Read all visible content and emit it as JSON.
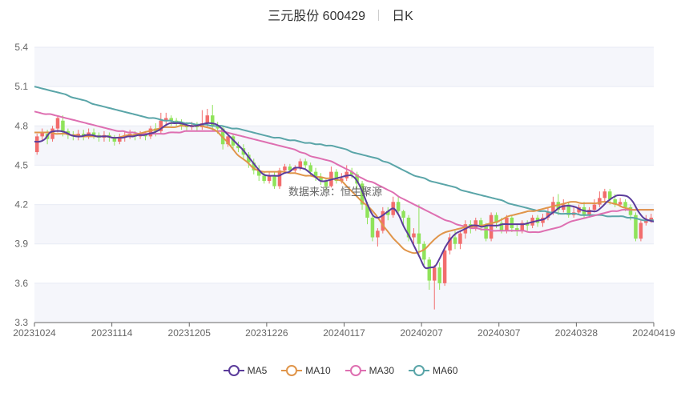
{
  "header": {
    "stock": "三元股份 600429",
    "period": "日K"
  },
  "watermark": "数据来源：恒生聚源",
  "legend": [
    {
      "label": "MA5",
      "color": "#5b3c9b"
    },
    {
      "label": "MA10",
      "color": "#e0954a"
    },
    {
      "label": "MA30",
      "color": "#de6fb1"
    },
    {
      "label": "MA60",
      "color": "#5aa5a8"
    }
  ],
  "colors": {
    "up": "#f26d6d",
    "down": "#8fe35a",
    "grid": "#e8ebf5",
    "band": "#f5f6fb"
  },
  "chart_data": {
    "type": "candlestick",
    "y_axis": {
      "min": 3.3,
      "max": 5.4,
      "ticks": [
        "3.3",
        "3.6",
        "3.9",
        "4.2",
        "4.5",
        "4.8",
        "5.1",
        "5.4"
      ]
    },
    "x_axis": {
      "tick_labels": [
        "20231024",
        "20231114",
        "20231205",
        "20231226",
        "20240117",
        "20240207",
        "20240307",
        "20240328",
        "20240419"
      ]
    },
    "grid": true,
    "legend_position": "bottom-center",
    "candles": [
      [
        4.6,
        4.72,
        4.58,
        4.74
      ],
      [
        4.72,
        4.75,
        4.68,
        4.78
      ],
      [
        4.74,
        4.7,
        4.66,
        4.77
      ],
      [
        4.7,
        4.78,
        4.68,
        4.8
      ],
      [
        4.78,
        4.86,
        4.75,
        4.88
      ],
      [
        4.84,
        4.76,
        4.72,
        4.88
      ],
      [
        4.76,
        4.73,
        4.7,
        4.78
      ],
      [
        4.73,
        4.72,
        4.69,
        4.76
      ],
      [
        4.72,
        4.74,
        4.69,
        4.77
      ],
      [
        4.74,
        4.72,
        4.69,
        4.77
      ],
      [
        4.72,
        4.75,
        4.7,
        4.78
      ],
      [
        4.75,
        4.73,
        4.7,
        4.78
      ],
      [
        4.73,
        4.71,
        4.68,
        4.75
      ],
      [
        4.71,
        4.73,
        4.68,
        4.76
      ],
      [
        4.73,
        4.71,
        4.68,
        4.75
      ],
      [
        4.71,
        4.68,
        4.65,
        4.73
      ],
      [
        4.68,
        4.71,
        4.66,
        4.74
      ],
      [
        4.71,
        4.73,
        4.68,
        4.76
      ],
      [
        4.73,
        4.74,
        4.7,
        4.77
      ],
      [
        4.74,
        4.72,
        4.69,
        4.76
      ],
      [
        4.72,
        4.73,
        4.7,
        4.76
      ],
      [
        4.73,
        4.72,
        4.69,
        4.76
      ],
      [
        4.72,
        4.78,
        4.7,
        4.8
      ],
      [
        4.78,
        4.76,
        4.72,
        4.82
      ],
      [
        4.76,
        4.84,
        4.74,
        4.9
      ],
      [
        4.84,
        4.86,
        4.8,
        4.9
      ],
      [
        4.86,
        4.84,
        4.8,
        4.88
      ],
      [
        4.84,
        4.83,
        4.8,
        4.86
      ],
      [
        4.83,
        4.8,
        4.77,
        4.85
      ],
      [
        4.8,
        4.79,
        4.76,
        4.83
      ],
      [
        4.79,
        4.8,
        4.77,
        4.83
      ],
      [
        4.8,
        4.79,
        4.76,
        4.83
      ],
      [
        4.79,
        4.82,
        4.77,
        4.92
      ],
      [
        4.82,
        4.88,
        4.79,
        4.93
      ],
      [
        4.88,
        4.8,
        4.76,
        4.96
      ],
      [
        4.8,
        4.78,
        4.74,
        4.83
      ],
      [
        4.78,
        4.66,
        4.62,
        4.8
      ],
      [
        4.66,
        4.72,
        4.64,
        4.75
      ],
      [
        4.72,
        4.65,
        4.62,
        4.74
      ],
      [
        4.65,
        4.63,
        4.6,
        4.68
      ],
      [
        4.63,
        4.58,
        4.55,
        4.66
      ],
      [
        4.58,
        4.52,
        4.48,
        4.6
      ],
      [
        4.52,
        4.46,
        4.43,
        4.55
      ],
      [
        4.46,
        4.42,
        4.38,
        4.5
      ],
      [
        4.42,
        4.38,
        4.36,
        4.45
      ],
      [
        4.38,
        4.42,
        4.36,
        4.45
      ],
      [
        4.42,
        4.34,
        4.32,
        4.45
      ],
      [
        4.34,
        4.46,
        4.32,
        4.48
      ],
      [
        4.46,
        4.49,
        4.44,
        4.51
      ],
      [
        4.49,
        4.46,
        4.44,
        4.51
      ],
      [
        4.46,
        4.48,
        4.44,
        4.5
      ],
      [
        4.48,
        4.53,
        4.46,
        4.55
      ],
      [
        4.53,
        4.5,
        4.47,
        4.55
      ],
      [
        4.5,
        4.45,
        4.42,
        4.52
      ],
      [
        4.45,
        4.41,
        4.38,
        4.48
      ],
      [
        4.41,
        4.38,
        4.35,
        4.44
      ],
      [
        4.38,
        4.34,
        4.31,
        4.4
      ],
      [
        4.34,
        4.45,
        4.33,
        4.49
      ],
      [
        4.45,
        4.38,
        4.36,
        4.47
      ],
      [
        4.38,
        4.4,
        4.36,
        4.44
      ],
      [
        4.4,
        4.45,
        4.38,
        4.5
      ],
      [
        4.45,
        4.43,
        4.4,
        4.48
      ],
      [
        4.43,
        4.36,
        4.32,
        4.45
      ],
      [
        4.36,
        4.2,
        4.16,
        4.38
      ],
      [
        4.2,
        4.1,
        4.05,
        4.22
      ],
      [
        4.1,
        3.95,
        3.92,
        4.12
      ],
      [
        3.95,
        4.0,
        3.88,
        4.02
      ],
      [
        4.0,
        4.15,
        3.98,
        4.18
      ],
      [
        4.15,
        4.12,
        4.08,
        4.18
      ],
      [
        4.12,
        4.22,
        4.1,
        4.26
      ],
      [
        4.22,
        4.15,
        4.12,
        4.26
      ],
      [
        4.15,
        4.1,
        4.04,
        4.16
      ],
      [
        4.1,
        3.95,
        3.92,
        4.12
      ],
      [
        3.95,
        3.98,
        3.9,
        4.02
      ],
      [
        3.98,
        3.9,
        3.8,
        4.2
      ],
      [
        3.9,
        3.78,
        3.74,
        3.92
      ],
      [
        3.78,
        3.62,
        3.55,
        3.8
      ],
      [
        3.62,
        3.72,
        3.4,
        3.74
      ],
      [
        3.72,
        3.6,
        3.55,
        3.76
      ],
      [
        3.6,
        3.85,
        3.58,
        3.88
      ],
      [
        3.85,
        3.95,
        3.82,
        3.98
      ],
      [
        3.95,
        3.9,
        3.86,
        4.0
      ],
      [
        3.9,
        3.98,
        3.86,
        4.0
      ],
      [
        3.98,
        4.05,
        3.94,
        4.08
      ],
      [
        4.05,
        4.02,
        3.98,
        4.08
      ],
      [
        4.02,
        4.08,
        4.0,
        4.1
      ],
      [
        4.08,
        4.04,
        4.0,
        4.1
      ],
      [
        4.04,
        3.94,
        3.92,
        4.06
      ],
      [
        3.94,
        4.12,
        3.92,
        4.14
      ],
      [
        4.12,
        4.06,
        4.02,
        4.14
      ],
      [
        4.06,
        4.0,
        3.98,
        4.1
      ],
      [
        4.0,
        4.1,
        3.98,
        4.12
      ],
      [
        4.1,
        4.02,
        3.99,
        4.12
      ],
      [
        4.02,
        4.0,
        3.96,
        4.05
      ],
      [
        4.0,
        4.06,
        3.98,
        4.08
      ],
      [
        4.06,
        4.04,
        4.0,
        4.08
      ],
      [
        4.04,
        4.1,
        4.02,
        4.12
      ],
      [
        4.1,
        4.06,
        4.03,
        4.12
      ],
      [
        4.06,
        4.1,
        4.03,
        4.13
      ],
      [
        4.1,
        4.14,
        4.08,
        4.18
      ],
      [
        4.14,
        4.22,
        4.12,
        4.26
      ],
      [
        4.22,
        4.16,
        4.12,
        4.28
      ],
      [
        4.16,
        4.2,
        4.14,
        4.24
      ],
      [
        4.2,
        4.12,
        4.1,
        4.22
      ],
      [
        4.12,
        4.14,
        4.1,
        4.18
      ],
      [
        4.14,
        4.18,
        4.12,
        4.2
      ],
      [
        4.18,
        4.12,
        4.1,
        4.22
      ],
      [
        4.12,
        4.16,
        4.1,
        4.18
      ],
      [
        4.16,
        4.2,
        4.14,
        4.24
      ],
      [
        4.2,
        4.25,
        4.18,
        4.3
      ],
      [
        4.25,
        4.3,
        4.22,
        4.32
      ],
      [
        4.3,
        4.24,
        4.2,
        4.32
      ],
      [
        4.24,
        4.2,
        4.18,
        4.28
      ],
      [
        4.2,
        4.22,
        4.18,
        4.25
      ],
      [
        4.22,
        4.18,
        4.15,
        4.24
      ],
      [
        4.18,
        4.12,
        4.08,
        4.2
      ],
      [
        4.12,
        3.94,
        3.92,
        4.14
      ],
      [
        3.94,
        4.06,
        3.92,
        4.09
      ],
      [
        4.06,
        4.08,
        4.04,
        4.12
      ],
      [
        4.08,
        4.1,
        4.06,
        4.13
      ]
    ],
    "series": [
      {
        "name": "MA5",
        "values": [
          4.68,
          4.68,
          4.7,
          4.75,
          4.76,
          4.76,
          4.75,
          4.73,
          4.72,
          4.72,
          4.73,
          4.73,
          4.72,
          4.72,
          4.72,
          4.71,
          4.71,
          4.71,
          4.72,
          4.72,
          4.73,
          4.73,
          4.74,
          4.75,
          4.77,
          4.8,
          4.82,
          4.82,
          4.82,
          4.81,
          4.8,
          4.8,
          4.81,
          4.82,
          4.82,
          4.81,
          4.78,
          4.74,
          4.7,
          4.66,
          4.62,
          4.57,
          4.52,
          4.47,
          4.43,
          4.42,
          4.42,
          4.42,
          4.44,
          4.45,
          4.48,
          4.48,
          4.47,
          4.44,
          4.41,
          4.38,
          4.38,
          4.39,
          4.4,
          4.41,
          4.42,
          4.42,
          4.38,
          4.3,
          4.2,
          4.12,
          4.1,
          4.12,
          4.15,
          4.17,
          4.12,
          4.03,
          3.96,
          3.88,
          3.8,
          3.72,
          3.72,
          3.73,
          3.8,
          3.88,
          3.94,
          3.98,
          4.0,
          4.02,
          4.04,
          4.04,
          4.03,
          4.04,
          4.04,
          4.04,
          4.05,
          4.05,
          4.05,
          4.05,
          4.05,
          4.06,
          4.07,
          4.08,
          4.09,
          4.12,
          4.15,
          4.18,
          4.19,
          4.19,
          4.18,
          4.16,
          4.15,
          4.15,
          4.15,
          4.18,
          4.22,
          4.25,
          4.27,
          4.27,
          4.26,
          4.22,
          4.15,
          4.1,
          4.08,
          4.07
        ]
      },
      {
        "name": "MA10",
        "values": [
          4.75,
          4.75,
          4.75,
          4.75,
          4.74,
          4.74,
          4.74,
          4.73,
          4.73,
          4.72,
          4.72,
          4.72,
          4.72,
          4.72,
          4.72,
          4.71,
          4.71,
          4.72,
          4.73,
          4.73,
          4.74,
          4.75,
          4.76,
          4.77,
          4.78,
          4.79,
          4.79,
          4.79,
          4.8,
          4.8,
          4.8,
          4.8,
          4.8,
          4.79,
          4.78,
          4.76,
          4.72,
          4.68,
          4.63,
          4.58,
          4.55,
          4.52,
          4.48,
          4.46,
          4.45,
          4.45,
          4.45,
          4.45,
          4.45,
          4.44,
          4.44,
          4.43,
          4.42,
          4.42,
          4.41,
          4.41,
          4.4,
          4.4,
          4.39,
          4.38,
          4.34,
          4.3,
          4.26,
          4.22,
          4.19,
          4.15,
          4.1,
          4.04,
          3.99,
          3.94,
          3.9,
          3.86,
          3.84,
          3.83,
          3.84,
          3.86,
          3.9,
          3.94,
          3.97,
          3.99,
          4.0,
          4.01,
          4.02,
          4.03,
          4.03,
          4.04,
          4.04,
          4.05,
          4.06,
          4.07,
          4.09,
          4.11,
          4.12,
          4.13,
          4.14,
          4.15,
          4.15,
          4.16,
          4.17,
          4.18,
          4.19,
          4.2,
          4.21,
          4.22,
          4.22,
          4.21,
          4.21,
          4.21,
          4.21,
          4.22,
          4.22,
          4.21,
          4.2,
          4.18,
          4.17,
          4.16,
          4.16,
          4.16,
          4.16,
          4.16
        ]
      },
      {
        "name": "MA30",
        "values": [
          4.91,
          4.9,
          4.89,
          4.89,
          4.88,
          4.87,
          4.86,
          4.85,
          4.84,
          4.83,
          4.82,
          4.81,
          4.8,
          4.79,
          4.78,
          4.77,
          4.76,
          4.76,
          4.75,
          4.75,
          4.74,
          4.74,
          4.74,
          4.74,
          4.74,
          4.74,
          4.75,
          4.75,
          4.75,
          4.76,
          4.76,
          4.76,
          4.76,
          4.76,
          4.76,
          4.76,
          4.76,
          4.75,
          4.74,
          4.73,
          4.72,
          4.71,
          4.7,
          4.69,
          4.68,
          4.67,
          4.66,
          4.65,
          4.64,
          4.63,
          4.62,
          4.6,
          4.59,
          4.57,
          4.56,
          4.55,
          4.54,
          4.53,
          4.51,
          4.49,
          4.47,
          4.45,
          4.42,
          4.4,
          4.38,
          4.37,
          4.35,
          4.33,
          4.31,
          4.29,
          4.26,
          4.24,
          4.22,
          4.2,
          4.18,
          4.16,
          4.14,
          4.12,
          4.1,
          4.08,
          4.07,
          4.05,
          4.04,
          4.03,
          4.02,
          4.02,
          4.01,
          4.01,
          4.0,
          4.0,
          4.0,
          4.0,
          4.0,
          4.0,
          4.0,
          3.99,
          3.99,
          3.99,
          4.0,
          4.01,
          4.02,
          4.03,
          4.05,
          4.07,
          4.08,
          4.09,
          4.1,
          4.11,
          4.12,
          4.13,
          4.14,
          4.15,
          4.15,
          4.16,
          4.16,
          4.16,
          4.16,
          4.16,
          4.16,
          4.16
        ]
      },
      {
        "name": "MA60",
        "values": [
          5.1,
          5.09,
          5.08,
          5.07,
          5.06,
          5.05,
          5.04,
          5.02,
          5.01,
          5.0,
          4.99,
          4.97,
          4.96,
          4.95,
          4.94,
          4.93,
          4.92,
          4.91,
          4.9,
          4.89,
          4.88,
          4.87,
          4.86,
          4.86,
          4.85,
          4.84,
          4.84,
          4.83,
          4.83,
          4.82,
          4.82,
          4.81,
          4.81,
          4.81,
          4.8,
          4.8,
          4.8,
          4.79,
          4.78,
          4.78,
          4.77,
          4.76,
          4.75,
          4.74,
          4.73,
          4.72,
          4.71,
          4.71,
          4.7,
          4.69,
          4.69,
          4.68,
          4.67,
          4.67,
          4.66,
          4.66,
          4.65,
          4.65,
          4.64,
          4.63,
          4.62,
          4.6,
          4.59,
          4.58,
          4.57,
          4.56,
          4.55,
          4.53,
          4.52,
          4.5,
          4.48,
          4.46,
          4.44,
          4.42,
          4.41,
          4.4,
          4.38,
          4.37,
          4.36,
          4.35,
          4.34,
          4.33,
          4.31,
          4.3,
          4.29,
          4.28,
          4.27,
          4.26,
          4.25,
          4.24,
          4.23,
          4.21,
          4.2,
          4.19,
          4.18,
          4.17,
          4.16,
          4.15,
          4.15,
          4.14,
          4.14,
          4.13,
          4.13,
          4.13,
          4.13,
          4.12,
          4.12,
          4.12,
          4.12,
          4.12,
          4.11,
          4.11,
          4.11,
          4.11,
          4.1,
          4.1,
          4.09,
          4.08,
          4.08,
          4.08
        ]
      }
    ]
  }
}
